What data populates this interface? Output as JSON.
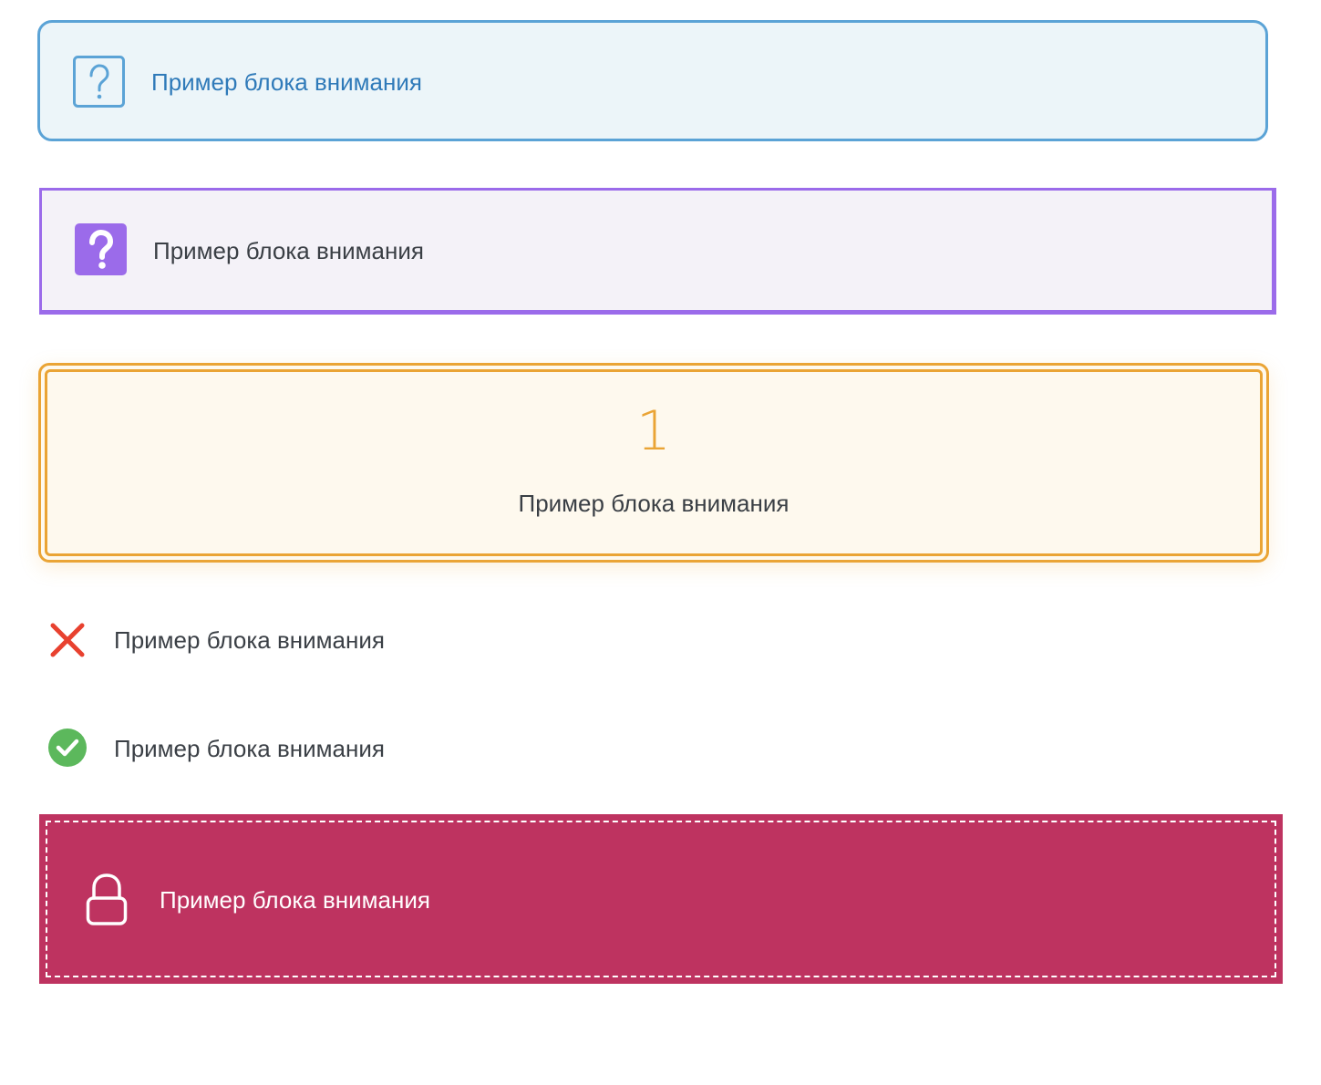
{
  "blocks": [
    {
      "id": "info-blue",
      "icon": "question-square-outline-icon",
      "text": "Пример блока внимания",
      "accent": "#5ba3d6",
      "background": "#ecf5f9"
    },
    {
      "id": "info-purple",
      "icon": "question-square-filled-icon",
      "text": "Пример блока внимания",
      "accent": "#9b6bea",
      "background": "#f4f2f8"
    },
    {
      "id": "numbered-orange",
      "number": "1",
      "text": "Пример блока внимания",
      "accent": "#eaa435",
      "background": "#fef9ee"
    },
    {
      "id": "error-red",
      "icon": "cross-icon",
      "text": "Пример блока внимания",
      "accent": "#e8412f"
    },
    {
      "id": "success-green",
      "icon": "check-circle-icon",
      "text": "Пример блока внимания",
      "accent": "#5cb85c"
    },
    {
      "id": "locked-magenta",
      "icon": "lock-icon",
      "text": "Пример блока внимания",
      "accent": "#be3360"
    }
  ]
}
